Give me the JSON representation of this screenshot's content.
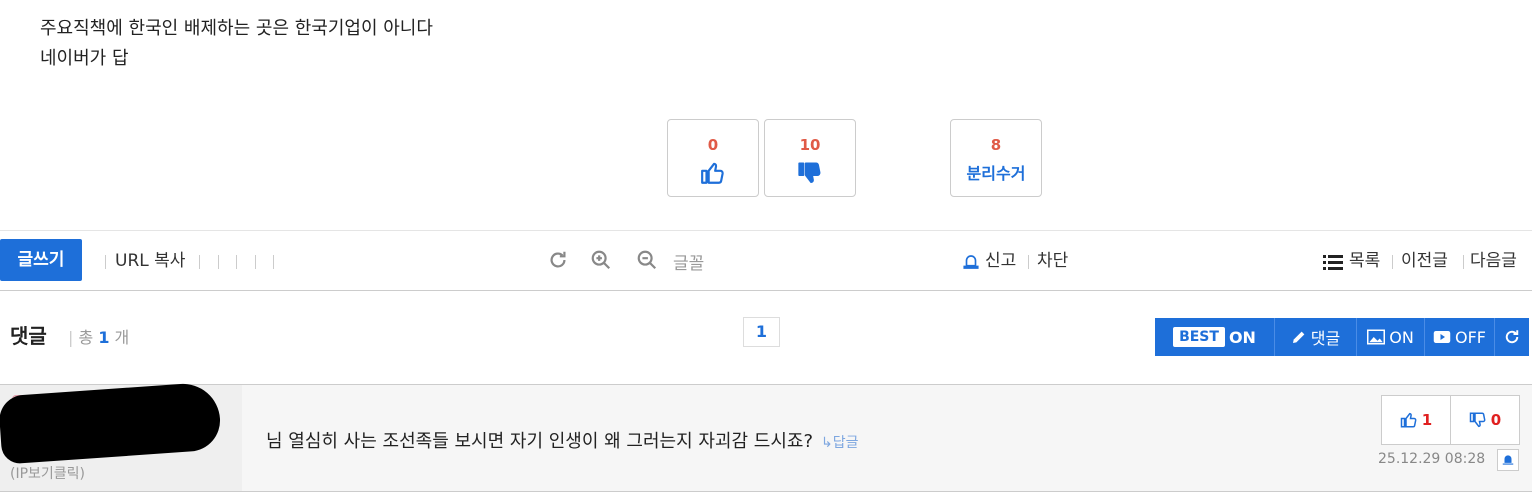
{
  "post": {
    "line1": "주요직책에 한국인 배제하는 곳은 한국기업이 아니다",
    "line2": "네이버가 답"
  },
  "votes": {
    "up_count": "0",
    "down_count": "10",
    "separate_count": "8",
    "separate_label": "분리수거",
    "up_icon": "thumbs-up-icon",
    "down_icon": "thumbs-down-icon"
  },
  "toolbar": {
    "write_label": "글쓰기",
    "url_copy_label": "URL 복사",
    "font_label": "글꼴",
    "report_label": "신고",
    "block_label": "차단",
    "list_label": "목록",
    "prev_label": "이전글",
    "next_label": "다음글"
  },
  "comments_header": {
    "title": "댓글",
    "count_prefix": "총",
    "count": "1",
    "count_suffix": "개",
    "page": "1",
    "best_badge": "BEST",
    "best_state": "ON",
    "write_comment": "댓글",
    "image_state": "ON",
    "video_state": "OFF"
  },
  "comment": {
    "ip_label": "(IP보기클릭)",
    "text": "님 열심히 사는 조선족들 보시면 자기 인생이 왜 그러는지 자괴감 드시죠?",
    "reply_label": "↳답글",
    "up": "1",
    "down": "0",
    "date": "25.12.29 08:28"
  },
  "colors": {
    "accent": "#1e6fd9",
    "vote_count": "#e05a47",
    "redaction": "#000000"
  }
}
